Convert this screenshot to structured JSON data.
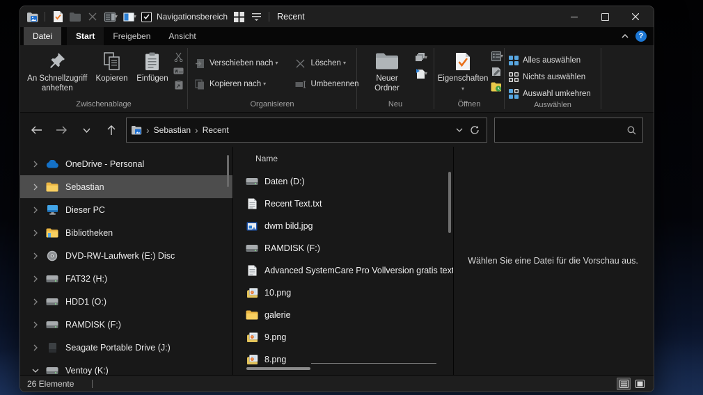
{
  "colors": {
    "accent_blue": "#58a6e0",
    "folder_yellow": "#f6c63e",
    "selection_gray": "#4d4d4d",
    "check_orange": "#e8701a",
    "window_bg": "#181818"
  },
  "icons": {
    "help_glyph": "?",
    "breadcrumb_chevron": "›",
    "dropdown_arrow": "▾"
  },
  "titlebar": {
    "title": "Recent",
    "nav_checkbox_label": "Navigationsbereich"
  },
  "tabs": {
    "datei": "Datei",
    "start": "Start",
    "freigeben": "Freigeben",
    "ansicht": "Ansicht"
  },
  "ribbon": {
    "clipboard": {
      "pin": "An Schnellzugriff anheften",
      "copy": "Kopieren",
      "paste": "Einfügen",
      "group": "Zwischenablage"
    },
    "organize": {
      "move": "Verschieben nach",
      "copyto": "Kopieren nach",
      "del": "Löschen",
      "rename": "Umbenennen",
      "group": "Organisieren"
    },
    "neu": {
      "newfolder": "Neuer Ordner",
      "group": "Neu"
    },
    "oeffnen": {
      "properties": "Eigenschaften",
      "group": "Öffnen"
    },
    "auswaehlen": {
      "all": "Alles auswählen",
      "none": "Nichts auswählen",
      "invert": "Auswahl umkehren",
      "group": "Auswählen"
    }
  },
  "addressbar": {
    "crumb1": "Sebastian",
    "crumb2": "Recent",
    "search_value": ""
  },
  "sidebar": {
    "items": [
      {
        "label": "OneDrive - Personal"
      },
      {
        "label": "Sebastian"
      },
      {
        "label": "Dieser PC"
      },
      {
        "label": "Bibliotheken"
      },
      {
        "label": "DVD-RW-Laufwerk (E:) Disc"
      },
      {
        "label": "FAT32 (H:)"
      },
      {
        "label": "HDD1 (O:)"
      },
      {
        "label": "RAMDISK (F:)"
      },
      {
        "label": "Seagate Portable Drive (J:)"
      },
      {
        "label": "Ventoy (K:)"
      }
    ]
  },
  "filelist": {
    "header": "Name",
    "items": [
      {
        "name": "Daten (D:)"
      },
      {
        "name": "Recent Text.txt"
      },
      {
        "name": "dwm bild.jpg"
      },
      {
        "name": "RAMDISK (F:)"
      },
      {
        "name": "Advanced SystemCare Pro Vollversion gratis text"
      },
      {
        "name": "10.png"
      },
      {
        "name": "galerie"
      },
      {
        "name": "9.png"
      },
      {
        "name": "8.png"
      }
    ]
  },
  "preview": {
    "placeholder": "Wählen Sie eine Datei für die Vorschau aus."
  },
  "statusbar": {
    "count": "26 Elemente"
  }
}
